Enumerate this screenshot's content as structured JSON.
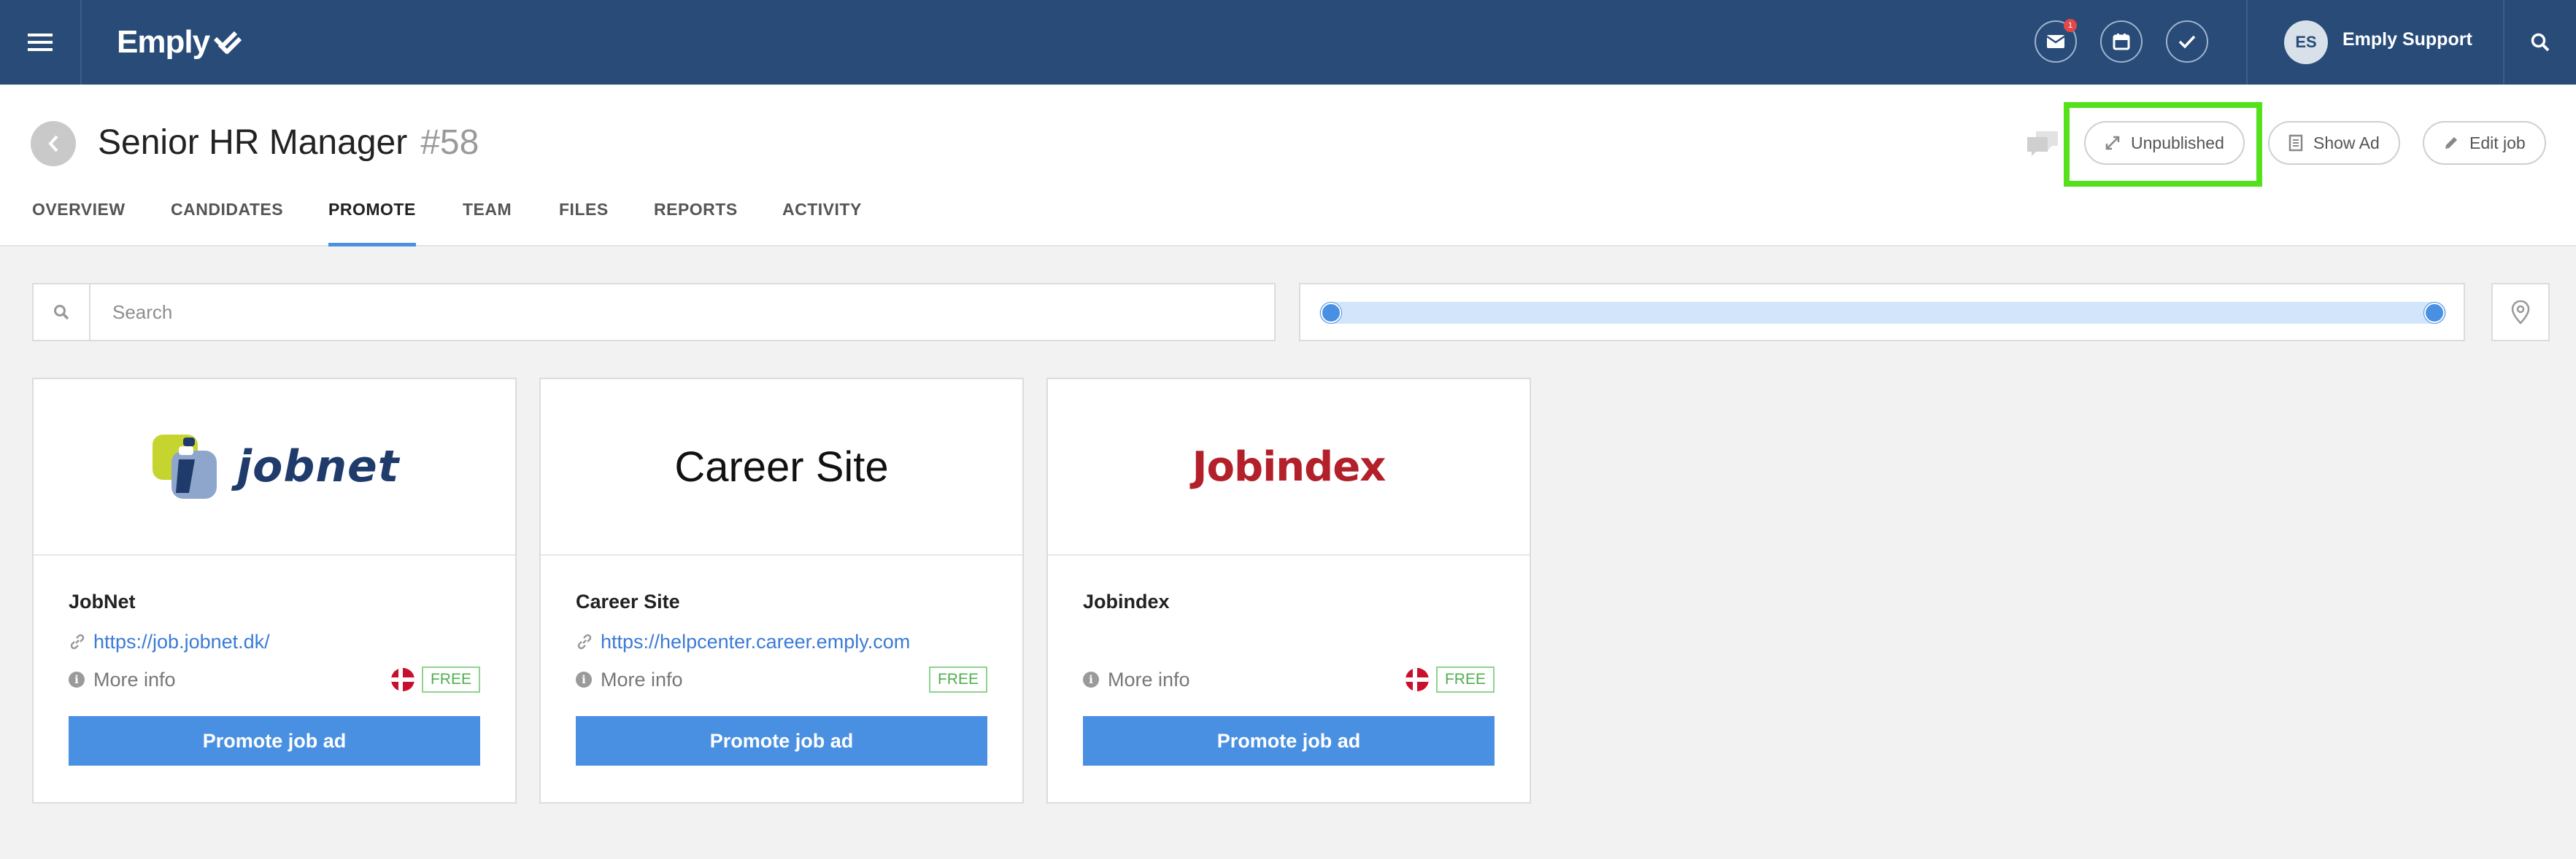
{
  "topbar": {
    "brand": "Emply",
    "notification_count": "1",
    "user_initials": "ES",
    "user_name": "Emply Support"
  },
  "job": {
    "title": "Senior HR Manager",
    "number": "#58"
  },
  "actions": {
    "unpublished_label": "Unpublished",
    "show_ad_label": "Show Ad",
    "edit_job_label": "Edit job"
  },
  "tabs": [
    {
      "label": "OVERVIEW"
    },
    {
      "label": "CANDIDATES"
    },
    {
      "label": "PROMOTE",
      "active": true
    },
    {
      "label": "TEAM"
    },
    {
      "label": "FILES"
    },
    {
      "label": "REPORTS"
    },
    {
      "label": "ACTIVITY"
    }
  ],
  "filters": {
    "search_placeholder": "Search",
    "range_min_fraction": 0.0,
    "range_max_fraction": 1.0
  },
  "cards": [
    {
      "logo_text": "jobnet",
      "name": "JobNet",
      "url": "https://job.jobnet.dk/",
      "more_info": "More info",
      "flag": "DK",
      "badge": "FREE",
      "button": "Promote job ad"
    },
    {
      "logo_text": "Career Site",
      "name": "Career Site",
      "url": "https://helpcenter.career.emply.com",
      "more_info": "More info",
      "badge": "FREE",
      "button": "Promote job ad"
    },
    {
      "logo_text": "Jobindex",
      "name": "Jobindex",
      "url": "",
      "more_info": "More info",
      "flag": "DK",
      "badge": "FREE",
      "button": "Promote job ad"
    }
  ],
  "colors": {
    "topbar": "#284b78",
    "accent": "#4a90e2",
    "highlight": "#55e01c",
    "free_badge": "#4fae4f"
  }
}
